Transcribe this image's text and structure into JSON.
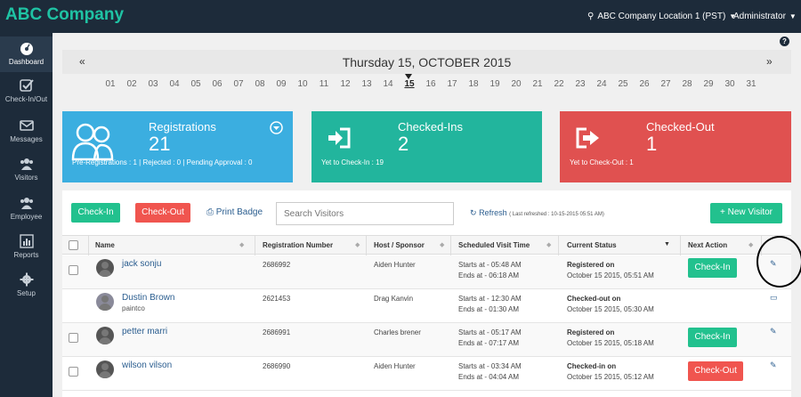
{
  "topbar": {
    "brand": "ABC Company",
    "location": "ABC Company Location 1 (PST)",
    "user": "Administrator"
  },
  "sidebar": {
    "items": [
      {
        "label": "Dashboard",
        "icon": "dashboard-icon"
      },
      {
        "label": "Check-In/Out",
        "icon": "checkmark-icon"
      },
      {
        "label": "Messages",
        "icon": "envelope-icon"
      },
      {
        "label": "Visitors",
        "icon": "users-icon"
      },
      {
        "label": "Employee",
        "icon": "users-icon"
      },
      {
        "label": "Reports",
        "icon": "bar-chart-icon"
      },
      {
        "label": "Setup",
        "icon": "gear-icon"
      }
    ]
  },
  "help": "?",
  "datebar": {
    "title": "Thursday 15, OCTOBER 2015",
    "prev": "«",
    "next": "»",
    "days": [
      "01",
      "02",
      "03",
      "04",
      "05",
      "06",
      "07",
      "08",
      "09",
      "10",
      "11",
      "12",
      "13",
      "14",
      "15",
      "16",
      "17",
      "18",
      "19",
      "20",
      "21",
      "22",
      "23",
      "24",
      "25",
      "26",
      "27",
      "28",
      "29",
      "30",
      "31"
    ],
    "selected": "15"
  },
  "cards": {
    "registrations": {
      "title": "Registrations",
      "count": "21",
      "sub": "Pre-Registrations : 1 | Rejected : 0 | Pending Approval : 0"
    },
    "checked_ins": {
      "title": "Checked-Ins",
      "count": "2",
      "sub": "Yet to Check-In : 19"
    },
    "checked_out": {
      "title": "Checked-Out",
      "count": "1",
      "sub": "Yet to Check-Out : 1"
    }
  },
  "toolbar": {
    "checkin": "Check-In",
    "checkout": "Check-Out",
    "print": "Print Badge",
    "search_placeholder": "Search Visitors",
    "refresh": "Refresh",
    "last_refreshed": "( Last refreshed : 10-15-2015 05:51 AM)",
    "new_visitor": "+ New Visitor"
  },
  "table": {
    "headers": [
      "Name",
      "Registration Number",
      "Host / Sponsor",
      "Scheduled Visit Time",
      "Current Status",
      "Next Action"
    ],
    "rows": [
      {
        "name": "jack sonju",
        "company": "",
        "reg": "2686992",
        "host": "Aiden Hunter",
        "starts": "Starts at - 05:48 AM",
        "ends": "Ends at - 06:18 AM",
        "status": "Registered on",
        "status_date": "October 15 2015, 05:51 AM",
        "action": "Check-In",
        "action_type": "green",
        "checkbox": true
      },
      {
        "name": "Dustin Brown",
        "company": "paintco",
        "reg": "2621453",
        "host": "Drag Kanvin",
        "starts": "Starts at - 12:30 AM",
        "ends": "Ends at - 01:30 AM",
        "status": "Checked-out on",
        "status_date": "October 15 2015, 05:30 AM",
        "action": "",
        "action_type": "none",
        "checkbox": false
      },
      {
        "name": "petter marri",
        "company": "",
        "reg": "2686991",
        "host": "Charles brener",
        "starts": "Starts at - 05:17 AM",
        "ends": "Ends at - 07:17 AM",
        "status": "Registered on",
        "status_date": "October 15 2015, 05:18 AM",
        "action": "Check-In",
        "action_type": "green",
        "checkbox": true
      },
      {
        "name": "wilson vilson",
        "company": "",
        "reg": "2686990",
        "host": "Aiden Hunter",
        "starts": "Starts at - 03:34 AM",
        "ends": "Ends at - 04:04 AM",
        "status": "Checked-in on",
        "status_date": "October 15 2015, 05:12 AM",
        "action": "Check-Out",
        "action_type": "red",
        "checkbox": true
      }
    ]
  },
  "colors": {
    "nav_bg": "#1d2b3a",
    "brand": "#1fc3a4",
    "blue_card": "#3baee0",
    "green_card": "#22b59d",
    "red_card": "#e05150"
  }
}
